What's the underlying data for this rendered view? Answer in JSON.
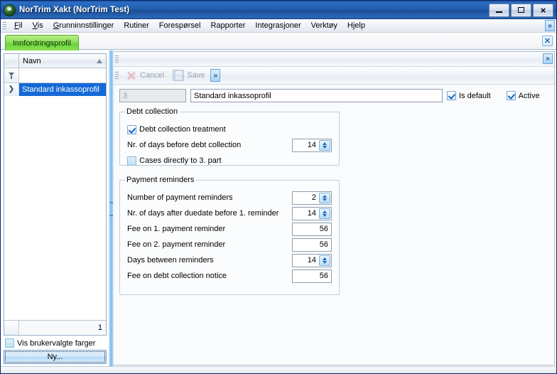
{
  "window": {
    "title": "NorTrim Xakt (NorTrim Test)",
    "app_icon": "globe-icon",
    "minimize_label": "_",
    "maximize_label": "□",
    "close_label": "×"
  },
  "menubar": {
    "items": [
      {
        "label": "Fil",
        "accel": "F"
      },
      {
        "label": "Vis",
        "accel": "V"
      },
      {
        "label": "Grunninnstillinger",
        "accel": "G"
      },
      {
        "label": "Rutiner",
        "accel": ""
      },
      {
        "label": "Forespørsel",
        "accel": ""
      },
      {
        "label": "Rapporter",
        "accel": ""
      },
      {
        "label": "Integrasjoner",
        "accel": ""
      },
      {
        "label": "Verktøy",
        "accel": ""
      },
      {
        "label": "Hjelp",
        "accel": ""
      }
    ],
    "overflow_label": "»"
  },
  "tabstrip": {
    "active_tab": "Innfordringsprofil",
    "close_label": "✕"
  },
  "left_panel": {
    "grid": {
      "column_header": "Navn",
      "sort_direction": "ascending",
      "filter_placeholder": "",
      "filter_value": "",
      "row_indicator": "❯",
      "rows": [
        {
          "name": "Standard inkassoprofil",
          "selected": true
        }
      ],
      "footer_count": "1"
    },
    "show_colors_checkbox": {
      "label": "Vis brukervalgte farger",
      "checked": false
    },
    "new_button": "Ny..."
  },
  "right_panel": {
    "toolstrip_overflow": "»",
    "toolbar": {
      "cancel_label": "Cancel",
      "save_label": "Save",
      "overflow_label": "»",
      "enabled": false
    },
    "header_row": {
      "id_value": "3",
      "name_value": "Standard inkassoprofil",
      "is_default": {
        "label": "Is default",
        "checked": true
      },
      "active": {
        "label": "Active",
        "checked": true
      }
    },
    "debt_collection_group": {
      "legend": "Debt collection",
      "treatment_checkbox": {
        "label": "Debt collection treatment",
        "checked": true
      },
      "days_before": {
        "label": "Nr. of days before debt collection",
        "value": "14"
      },
      "third_party_checkbox": {
        "label": "Cases directly to 3. part",
        "checked": false
      }
    },
    "payment_reminders_group": {
      "legend": "Payment reminders",
      "fields": [
        {
          "label": "Number of payment reminders",
          "value": "2",
          "type": "spinner"
        },
        {
          "label": "Nr. of days after duedate before 1. reminder",
          "value": "14",
          "type": "spinner"
        },
        {
          "label": "Fee on 1. payment reminder",
          "value": "56",
          "type": "number"
        },
        {
          "label": "Fee on 2. payment reminder",
          "value": "56",
          "type": "number"
        },
        {
          "label": "Days between reminders",
          "value": "14",
          "type": "spinner"
        },
        {
          "label": "Fee on debt collection notice",
          "value": "56",
          "type": "number"
        }
      ]
    }
  },
  "colors": {
    "titlebar": "#1f5ba8",
    "tab_active": "#8ce05b",
    "row_selected": "#1569d6",
    "splitter": "#7dbdee",
    "accent_blue": "#1a6bbd"
  }
}
